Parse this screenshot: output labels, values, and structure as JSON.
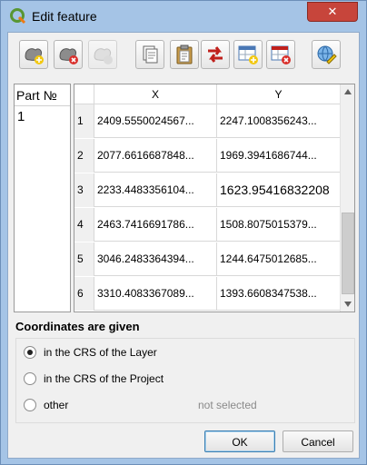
{
  "window": {
    "title": "Edit feature",
    "close_glyph": "✕"
  },
  "toolbar": {
    "buttons": [
      {
        "icon": "add-part-icon",
        "enabled": true
      },
      {
        "icon": "delete-part-icon",
        "enabled": true
      },
      {
        "icon": "copy-part-icon",
        "enabled": false
      },
      {
        "icon": "copy-icon",
        "enabled": true
      },
      {
        "icon": "paste-icon",
        "enabled": true
      },
      {
        "icon": "reverse-icon",
        "enabled": true
      },
      {
        "icon": "add-vertex-icon",
        "enabled": true
      },
      {
        "icon": "delete-vertex-icon",
        "enabled": true
      },
      {
        "icon": "crs-icon",
        "enabled": true
      }
    ]
  },
  "parts": {
    "header": "Part №",
    "items": [
      "1"
    ]
  },
  "grid": {
    "columns": [
      "X",
      "Y"
    ],
    "rows": [
      {
        "n": "1",
        "x": "2409.5550024567...",
        "y": "2247.1008356243..."
      },
      {
        "n": "2",
        "x": "2077.6616687848...",
        "y": "1969.3941686744..."
      },
      {
        "n": "3",
        "x": "2233.4483356104...",
        "y": "1623.95416832208"
      },
      {
        "n": "4",
        "x": "2463.7416691786...",
        "y": "1508.8075015379..."
      },
      {
        "n": "5",
        "x": "3046.2483364394...",
        "y": "1244.6475012685..."
      },
      {
        "n": "6",
        "x": "3310.4083367089...",
        "y": "1393.6608347538..."
      }
    ]
  },
  "coordinates": {
    "title": "Coordinates are given",
    "options": [
      {
        "label": "in the CRS of the Layer",
        "checked": true
      },
      {
        "label": "in the CRS of the Project",
        "checked": false
      },
      {
        "label": "other",
        "checked": false
      }
    ],
    "other_value": "not selected"
  },
  "buttons": {
    "ok": "OK",
    "cancel": "Cancel"
  },
  "colors": {
    "titlebar": "#a5c4e6",
    "close": "#c7453b",
    "qgis_green": "#589632"
  }
}
